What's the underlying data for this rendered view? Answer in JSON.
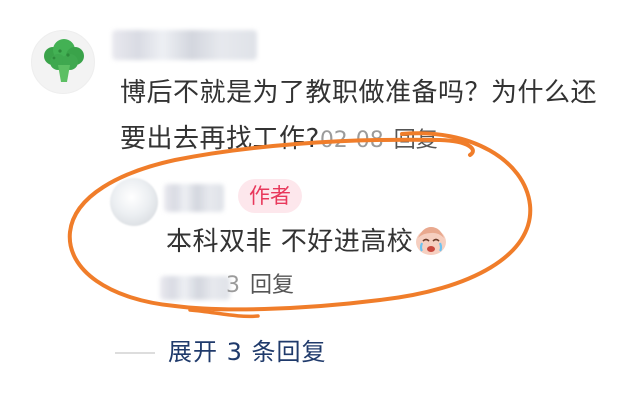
{
  "comment": {
    "text": "博后不就是为了教职做准备吗？为什么还要出去再找工作?",
    "time": "02-08",
    "reply_label": "回复"
  },
  "reply": {
    "badge": "作者",
    "text": "本科双非 不好进高校",
    "emoji": "crying-face-emoji",
    "time_fragment": "3",
    "reply_label": "回复"
  },
  "expand": {
    "label": "展开 3 条回复"
  },
  "colors": {
    "badge_text": "#e8385b",
    "badge_bg": "#fde7ec",
    "link": "#1f3a6b",
    "annotation": "#f07d2a"
  }
}
